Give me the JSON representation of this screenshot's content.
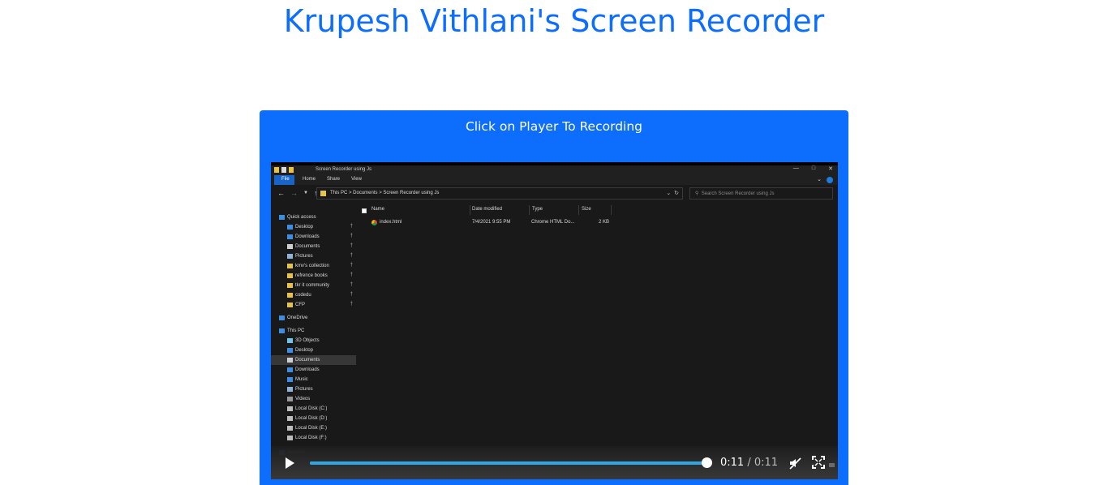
{
  "page": {
    "title": "Krupesh Vithlani's Screen Recorder",
    "caption": "Click on Player To Recording"
  },
  "colors": {
    "accent": "#0d6efd",
    "progress": "#2fa6e0"
  },
  "player": {
    "current_time": "0:11",
    "separator": "/",
    "duration": "0:11",
    "progress": 1.0,
    "controls": [
      "play-icon",
      "progress-bar",
      "mute-icon",
      "fullscreen-icon"
    ]
  },
  "recording": {
    "window_title": "Screen Recorder using Js",
    "tabs": [
      "File",
      "Home",
      "Share",
      "View"
    ],
    "breadcrumbs": "This PC  >  Documents  >  Screen Recorder using Js",
    "search_placeholder": "Search Screen Recorder using Js",
    "sidebar": [
      {
        "label": "Quick access",
        "icon": "star-icon",
        "color": "#3a8ee6"
      },
      {
        "label": "Desktop",
        "icon": "folder-icon",
        "color": "#3a8ee6",
        "pinned": true
      },
      {
        "label": "Downloads",
        "icon": "download-icon",
        "color": "#3a8ee6",
        "pinned": true
      },
      {
        "label": "Documents",
        "icon": "document-icon",
        "color": "#cfcfcf",
        "pinned": true
      },
      {
        "label": "Pictures",
        "icon": "picture-icon",
        "color": "#8fb4d8",
        "pinned": true
      },
      {
        "label": "kmv's collection",
        "icon": "folder-icon",
        "color": "#e7c24a",
        "pinned": true
      },
      {
        "label": "refrence books",
        "icon": "folder-icon",
        "color": "#e7c24a",
        "pinned": true
      },
      {
        "label": "tkr it community",
        "icon": "folder-icon",
        "color": "#e7c24a",
        "pinned": true
      },
      {
        "label": "codedu",
        "icon": "folder-icon",
        "color": "#e7c24a",
        "pinned": true
      },
      {
        "label": "CFP",
        "icon": "folder-icon",
        "color": "#e7c24a",
        "pinned": true
      },
      {
        "label": "OneDrive",
        "icon": "cloud-icon",
        "color": "#3a8ee6"
      },
      {
        "label": "This PC",
        "icon": "computer-icon",
        "color": "#3a8ee6"
      },
      {
        "label": "3D Objects",
        "icon": "cube-icon",
        "color": "#6fc3e8"
      },
      {
        "label": "Desktop",
        "icon": "folder-icon",
        "color": "#3a8ee6"
      },
      {
        "label": "Documents",
        "icon": "document-icon",
        "color": "#cfcfcf",
        "selected": true
      },
      {
        "label": "Downloads",
        "icon": "download-icon",
        "color": "#3a8ee6"
      },
      {
        "label": "Music",
        "icon": "music-icon",
        "color": "#3a8ee6"
      },
      {
        "label": "Pictures",
        "icon": "picture-icon",
        "color": "#8fb4d8"
      },
      {
        "label": "Videos",
        "icon": "video-icon",
        "color": "#9a9a9a"
      },
      {
        "label": "Local Disk (C:)",
        "icon": "drive-icon",
        "color": "#bdbdbd"
      },
      {
        "label": "Local Disk (D:)",
        "icon": "drive-icon",
        "color": "#bdbdbd"
      },
      {
        "label": "Local Disk (E:)",
        "icon": "drive-icon",
        "color": "#bdbdbd"
      },
      {
        "label": "Local Disk (F:)",
        "icon": "drive-icon",
        "color": "#bdbdbd"
      },
      {
        "label": "Network",
        "icon": "network-icon",
        "color": "#3a8ee6",
        "dim": true
      }
    ],
    "columns": [
      "Name",
      "Date modified",
      "Type",
      "Size"
    ],
    "files": [
      {
        "name": "index.html",
        "date": "7/4/2021 9:55 PM",
        "type": "Chrome HTML Do...",
        "size": "2 KB"
      }
    ]
  }
}
